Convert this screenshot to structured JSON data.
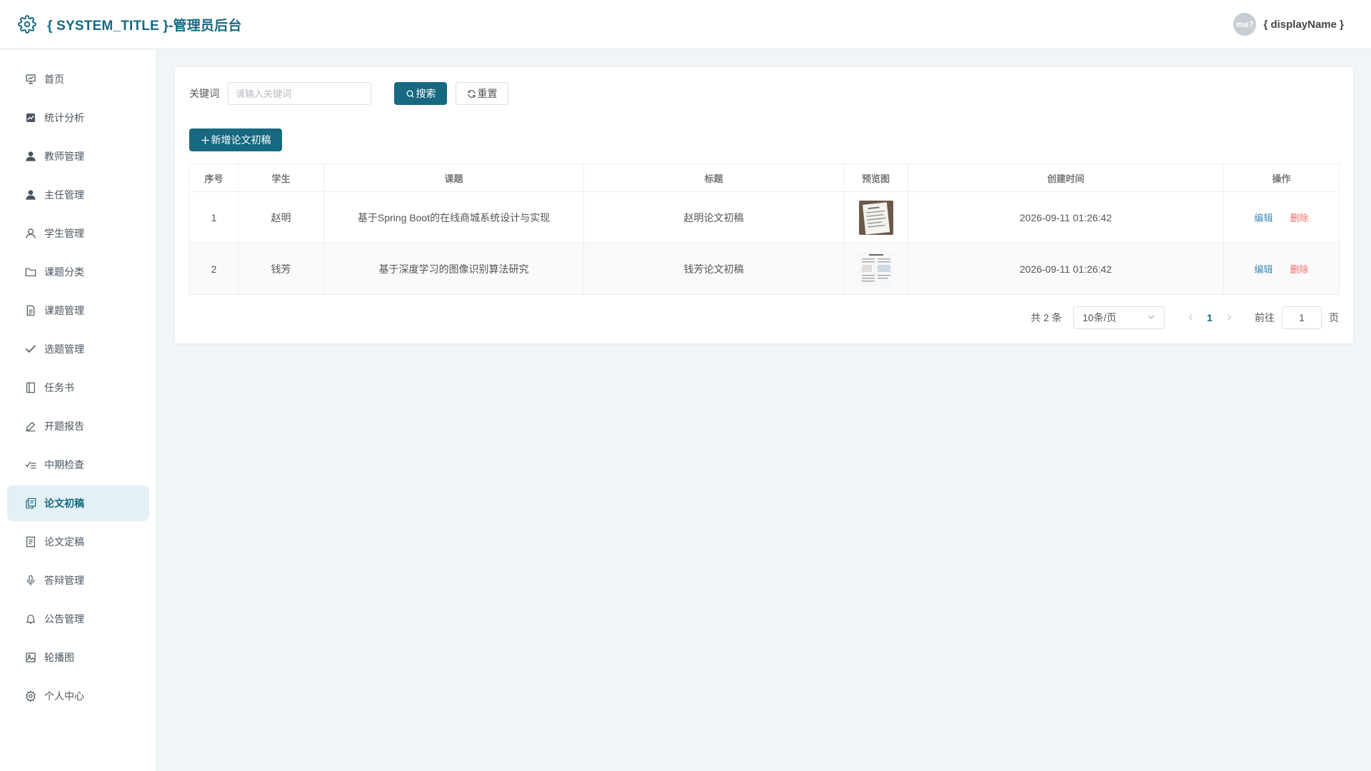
{
  "header": {
    "title": "{ SYSTEM_TITLE }-管理员后台",
    "avatar_text": "me?",
    "display_name": "{ displayName }"
  },
  "sidebar": {
    "items": [
      {
        "label": "首页",
        "icon": "presentation-board-icon"
      },
      {
        "label": "统计分析",
        "icon": "chart-icon"
      },
      {
        "label": "教师管理",
        "icon": "user-filled-icon"
      },
      {
        "label": "主任管理",
        "icon": "user-filled-icon"
      },
      {
        "label": "学生管理",
        "icon": "user-outline-icon"
      },
      {
        "label": "课题分类",
        "icon": "folder-icon"
      },
      {
        "label": "课题管理",
        "icon": "document-icon"
      },
      {
        "label": "选题管理",
        "icon": "check-icon"
      },
      {
        "label": "任务书",
        "icon": "notebook-icon"
      },
      {
        "label": "开题报告",
        "icon": "edit-pen-icon"
      },
      {
        "label": "中期检查",
        "icon": "checklist-icon"
      },
      {
        "label": "论文初稿",
        "icon": "copy-document-icon"
      },
      {
        "label": "论文定稿",
        "icon": "document-text-icon"
      },
      {
        "label": "答辩管理",
        "icon": "microphone-icon"
      },
      {
        "label": "公告管理",
        "icon": "bell-icon"
      },
      {
        "label": "轮播图",
        "icon": "picture-icon"
      },
      {
        "label": "个人中心",
        "icon": "gear-icon"
      }
    ],
    "active_index": 11
  },
  "search": {
    "label": "关键词",
    "placeholder": "请输入关键词",
    "value": "",
    "search_button": "搜索",
    "reset_button": "重置"
  },
  "toolbar": {
    "add_button": "新增论文初稿"
  },
  "table": {
    "columns": [
      "序号",
      "学生",
      "课题",
      "标题",
      "预览图",
      "创建时间",
      "操作"
    ],
    "rows": [
      {
        "index": "1",
        "student": "赵明",
        "topic": "基于Spring Boot的在线商城系统设计与实现",
        "title": "赵明论文初稿",
        "created": "2026-09-11 01:26:42",
        "edit": "编辑",
        "delete": "删除"
      },
      {
        "index": "2",
        "student": "钱芳",
        "topic": "基于深度学习的图像识别算法研究",
        "title": "钱芳论文初稿",
        "created": "2026-09-11 01:26:42",
        "edit": "编辑",
        "delete": "删除"
      }
    ]
  },
  "pagination": {
    "total_text": "共 2 条",
    "page_size": "10条/页",
    "current_page": "1",
    "goto_label": "前往",
    "goto_value": "1",
    "page_unit": "页"
  },
  "colors": {
    "primary": "#16697f",
    "danger": "#f56c6c",
    "link": "#3d8cb4",
    "background": "#f0f5f8",
    "active_menu_bg": "#e3f0f5"
  }
}
